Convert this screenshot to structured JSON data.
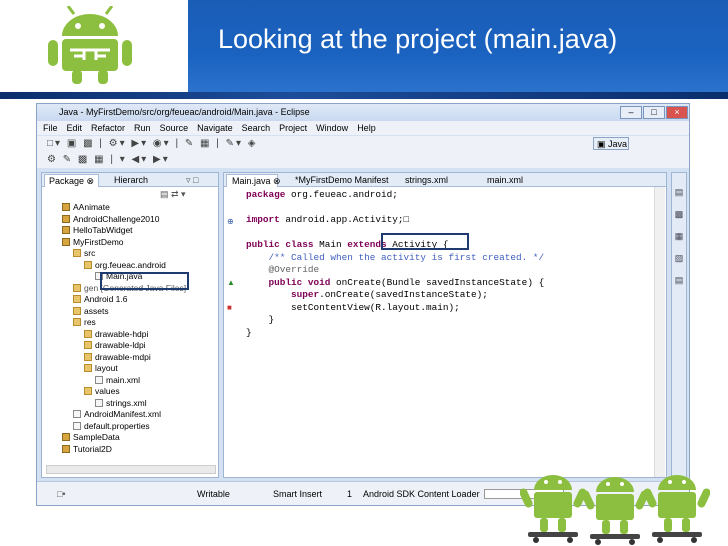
{
  "slide": {
    "title": "Looking at the project (main.java)",
    "logo_icon": "android-robot-icon",
    "decor_icon": "android-skateboard-icon"
  },
  "eclipse": {
    "window_title": "Java - MyFirstDemo/src/org/feueac/android/Main.java - Eclipse",
    "menu": [
      "File",
      "Edit",
      "Refactor",
      "Run",
      "Source",
      "Navigate",
      "Search",
      "Project",
      "Window",
      "Help"
    ],
    "perspective_label": "Java",
    "package_explorer": {
      "tabs": [
        "Package",
        "Hierarch"
      ],
      "tree": [
        {
          "label": "AAnimate",
          "indent": 0,
          "kind": "proj"
        },
        {
          "label": "AndroidChallenge2010",
          "indent": 0,
          "kind": "proj"
        },
        {
          "label": "HelloTabWidget",
          "indent": 0,
          "kind": "proj"
        },
        {
          "label": "MyFirstDemo",
          "indent": 0,
          "kind": "proj"
        },
        {
          "label": "src",
          "indent": 1,
          "kind": "folder"
        },
        {
          "label": "org.feueac.android",
          "indent": 2,
          "kind": "folder"
        },
        {
          "label": "Main.java",
          "indent": 3,
          "kind": "file"
        },
        {
          "label": "gen [Generated Java Files]",
          "indent": 1,
          "kind": "folder"
        },
        {
          "label": "Android 1.6",
          "indent": 1,
          "kind": "folder"
        },
        {
          "label": "assets",
          "indent": 1,
          "kind": "folder"
        },
        {
          "label": "res",
          "indent": 1,
          "kind": "folder"
        },
        {
          "label": "drawable-hdpi",
          "indent": 2,
          "kind": "folder"
        },
        {
          "label": "drawable-ldpi",
          "indent": 2,
          "kind": "folder"
        },
        {
          "label": "drawable-mdpi",
          "indent": 2,
          "kind": "folder"
        },
        {
          "label": "layout",
          "indent": 2,
          "kind": "folder"
        },
        {
          "label": "main.xml",
          "indent": 3,
          "kind": "file"
        },
        {
          "label": "values",
          "indent": 2,
          "kind": "folder"
        },
        {
          "label": "strings.xml",
          "indent": 3,
          "kind": "file"
        },
        {
          "label": "AndroidManifest.xml",
          "indent": 1,
          "kind": "file"
        },
        {
          "label": "default.properties",
          "indent": 1,
          "kind": "file"
        },
        {
          "label": "SampleData",
          "indent": 0,
          "kind": "proj"
        },
        {
          "label": "Tutorial2D",
          "indent": 0,
          "kind": "proj"
        }
      ]
    },
    "editor": {
      "tabs": [
        "Main.java",
        "*MyFirstDemo Manifest",
        "strings.xml",
        "main.xml"
      ],
      "code_lines": [
        {
          "html": "<span class=\"kw\">package</span> org.feueac.android;"
        },
        {
          "html": ""
        },
        {
          "html": "<span class=\"kw\">import</span> android.app.Activity;&#9633;"
        },
        {
          "html": ""
        },
        {
          "html": "<span class=\"kw\">public class</span> Main <span class=\"kw\">extends</span> Activity {"
        },
        {
          "html": "    <span class=\"cm\">/** Called when the activity is first created. */</span>"
        },
        {
          "html": "    <span class=\"an\">@Override</span>"
        },
        {
          "html": "    <span class=\"kw\">public void</span> onCreate(Bundle savedInstanceState) {"
        },
        {
          "html": "        <span class=\"kw\">super</span>.onCreate(savedInstanceState);"
        },
        {
          "html": "        setContentView(R.layout.main);"
        },
        {
          "html": "    }"
        },
        {
          "html": "}"
        }
      ]
    },
    "status": {
      "writable": "Writable",
      "insert_mode": "Smart Insert",
      "line": "1",
      "loader": "Android SDK Content Loader"
    }
  },
  "colors": {
    "title_bar": "#1b63c0",
    "keyword": "#7f0055",
    "comment": "#3f5fbf"
  }
}
